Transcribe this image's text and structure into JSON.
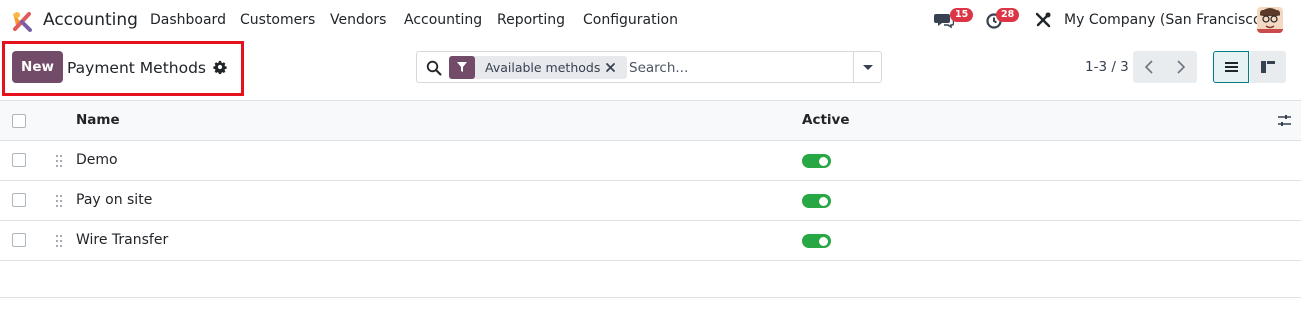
{
  "navbar": {
    "app_name": "Accounting",
    "menu": [
      "Dashboard",
      "Customers",
      "Vendors",
      "Accounting",
      "Reporting",
      "Configuration"
    ],
    "messages_count": "15",
    "activities_count": "28",
    "company": "My Company (San Francisco)"
  },
  "control_panel": {
    "new_label": "New",
    "title": "Payment Methods",
    "search": {
      "facet_label": "Available methods",
      "placeholder": "Search..."
    },
    "pager": "1-3 / 3"
  },
  "table": {
    "columns": [
      "Name",
      "Active"
    ],
    "rows": [
      {
        "name": "Demo",
        "active": true
      },
      {
        "name": "Pay on site",
        "active": true
      },
      {
        "name": "Wire Transfer",
        "active": true
      }
    ]
  },
  "colors": {
    "brand": "#714B67",
    "toggle_on": "#28a745",
    "badge": "#dc3545",
    "highlight": "#e5111d"
  }
}
